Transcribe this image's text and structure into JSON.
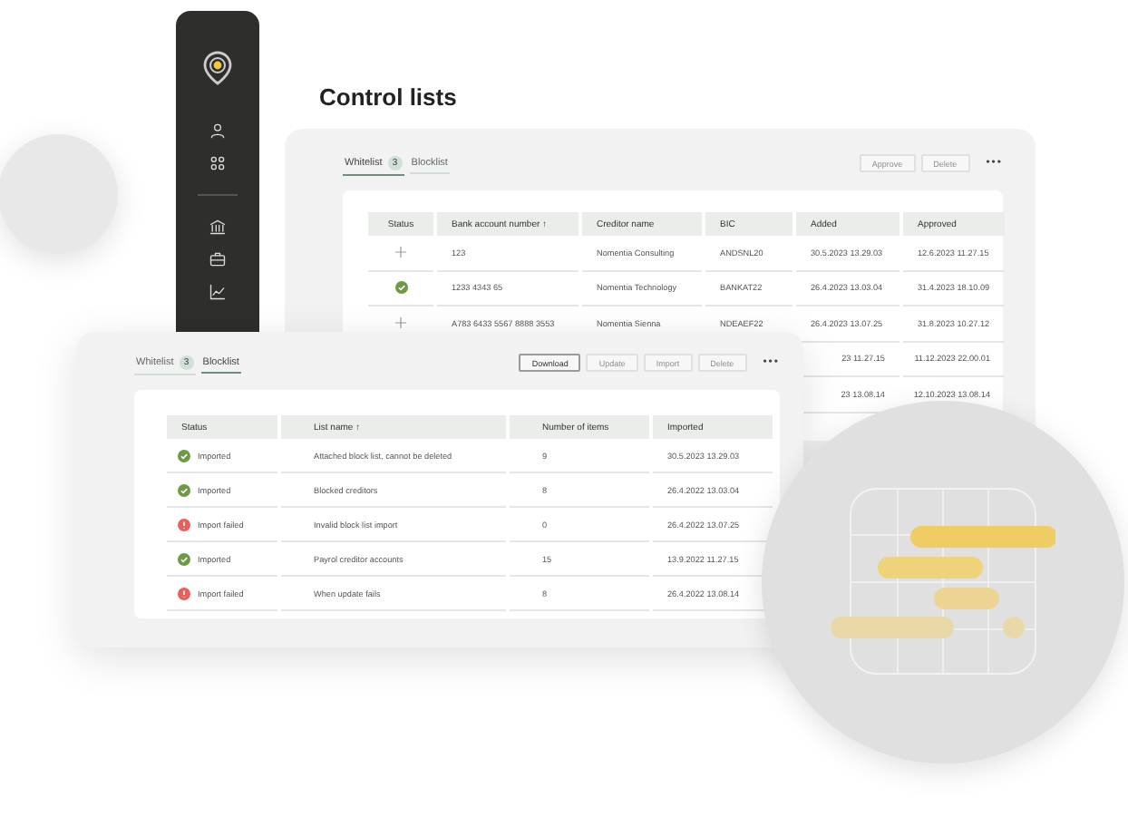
{
  "sidebar": {
    "items": [
      {
        "kind": "person"
      },
      {
        "kind": "grid"
      },
      {
        "kind": "divider"
      },
      {
        "kind": "bank"
      },
      {
        "kind": "briefcase"
      },
      {
        "kind": "chart"
      }
    ]
  },
  "title": "Control lists",
  "back_panel": {
    "tabs": [
      {
        "label": "Whitelist",
        "badge": "3",
        "selected": true
      },
      {
        "label": "Blocklist",
        "selected": false
      }
    ],
    "buttons": [
      {
        "label": "Approve",
        "disabled": true
      },
      {
        "label": "Delete",
        "disabled": true
      }
    ],
    "more": "•••",
    "table": {
      "columns": [
        "Status",
        "Bank account number ↑",
        "Creditor name",
        "BIC",
        "Added",
        "Approved"
      ],
      "rows": [
        {
          "kind": "pending",
          "account": "123",
          "creditor": "Nomentia Consulting",
          "bic": "ANDSNL20",
          "added": "30.5.2023 13.29.03",
          "approved": "12.6.2023 11.27.15"
        },
        {
          "kind": "approved",
          "account": "1233 4343 65",
          "creditor": "Nomentia Technology",
          "bic": "BANKAT22",
          "added": "26.4.2023 13.03.04",
          "approved": "31.4.2023 18.10.09"
        },
        {
          "kind": "pending",
          "account": "A783 6433 5567 8888 3553",
          "creditor": "Nomentia Sienna",
          "bic": "NDEAEF22",
          "added": "26.4.2023 13.07.25",
          "approved": "31.8.2023 10.27.12"
        },
        {
          "added": "23 11.27.15",
          "approved": "11.12.2023 22.00.01"
        },
        {
          "added": "23 13.08.14",
          "approved": "12.10.2023 13.08.14"
        }
      ]
    }
  },
  "front_panel": {
    "tabs": [
      {
        "label": "Whitelist",
        "badge": "3",
        "selected": false
      },
      {
        "label": "Blocklist",
        "selected": true
      }
    ],
    "buttons": [
      {
        "label": "Download",
        "disabled": false
      },
      {
        "label": "Update",
        "disabled": true
      },
      {
        "label": "Import",
        "disabled": true
      },
      {
        "label": "Delete",
        "disabled": true
      }
    ],
    "more": "•••",
    "table": {
      "columns": [
        "Status",
        "List name ↑",
        "Number of items",
        "Imported"
      ],
      "rows": [
        {
          "kind": "imported",
          "status": "Imported",
          "name": "Attached block list, cannot be deleted",
          "count": "9",
          "imported": "30.5.2023 13.29.03"
        },
        {
          "kind": "imported",
          "status": "Imported",
          "name": "Blocked creditors",
          "count": "8",
          "imported": "26.4.2022 13.03.04"
        },
        {
          "kind": "failed",
          "status": "Import failed",
          "name": "Invalid block list import",
          "count": "0",
          "imported": "26.4.2022 13.07.25"
        },
        {
          "kind": "imported",
          "status": "Imported",
          "name": "Payrol creditor accounts",
          "count": "15",
          "imported": "13.9.2022 11.27.15"
        },
        {
          "kind": "failed",
          "status": "Import failed",
          "name": "When update fails",
          "count": "8",
          "imported": "26.4.2022 13.08.14"
        }
      ]
    }
  }
}
